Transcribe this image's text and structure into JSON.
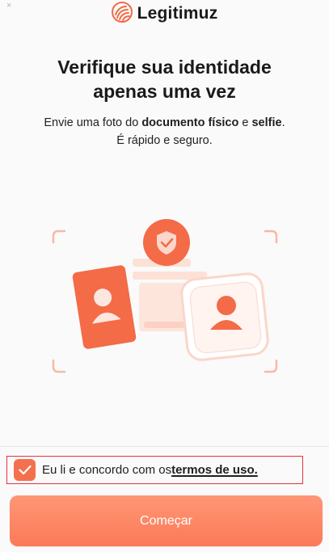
{
  "window": {
    "close_glyph": "×"
  },
  "brand": {
    "name": "Legitimuz",
    "logo_icon": "fingerprint-icon",
    "accent": "#f36b47"
  },
  "hero": {
    "title_line1": "Verifique sua identidade",
    "title_line2": "apenas uma vez",
    "subtitle_pre": "Envie uma foto do ",
    "subtitle_doc": "documento físico",
    "subtitle_mid": " e ",
    "subtitle_selfie": "selfie",
    "subtitle_end": ".",
    "subtitle_line2": "É rápido e seguro."
  },
  "illustration": {
    "icons": [
      "shield-check-icon",
      "id-card-icon",
      "selfie-frame-icon"
    ]
  },
  "consent": {
    "checked": true,
    "text": "Eu li e concordo com os ",
    "link_text": "termos de uso."
  },
  "actions": {
    "start_label": "Começar"
  },
  "colors": {
    "primary": "#f36b47",
    "primary_light": "#ff9676",
    "error_border": "#e5323f"
  }
}
